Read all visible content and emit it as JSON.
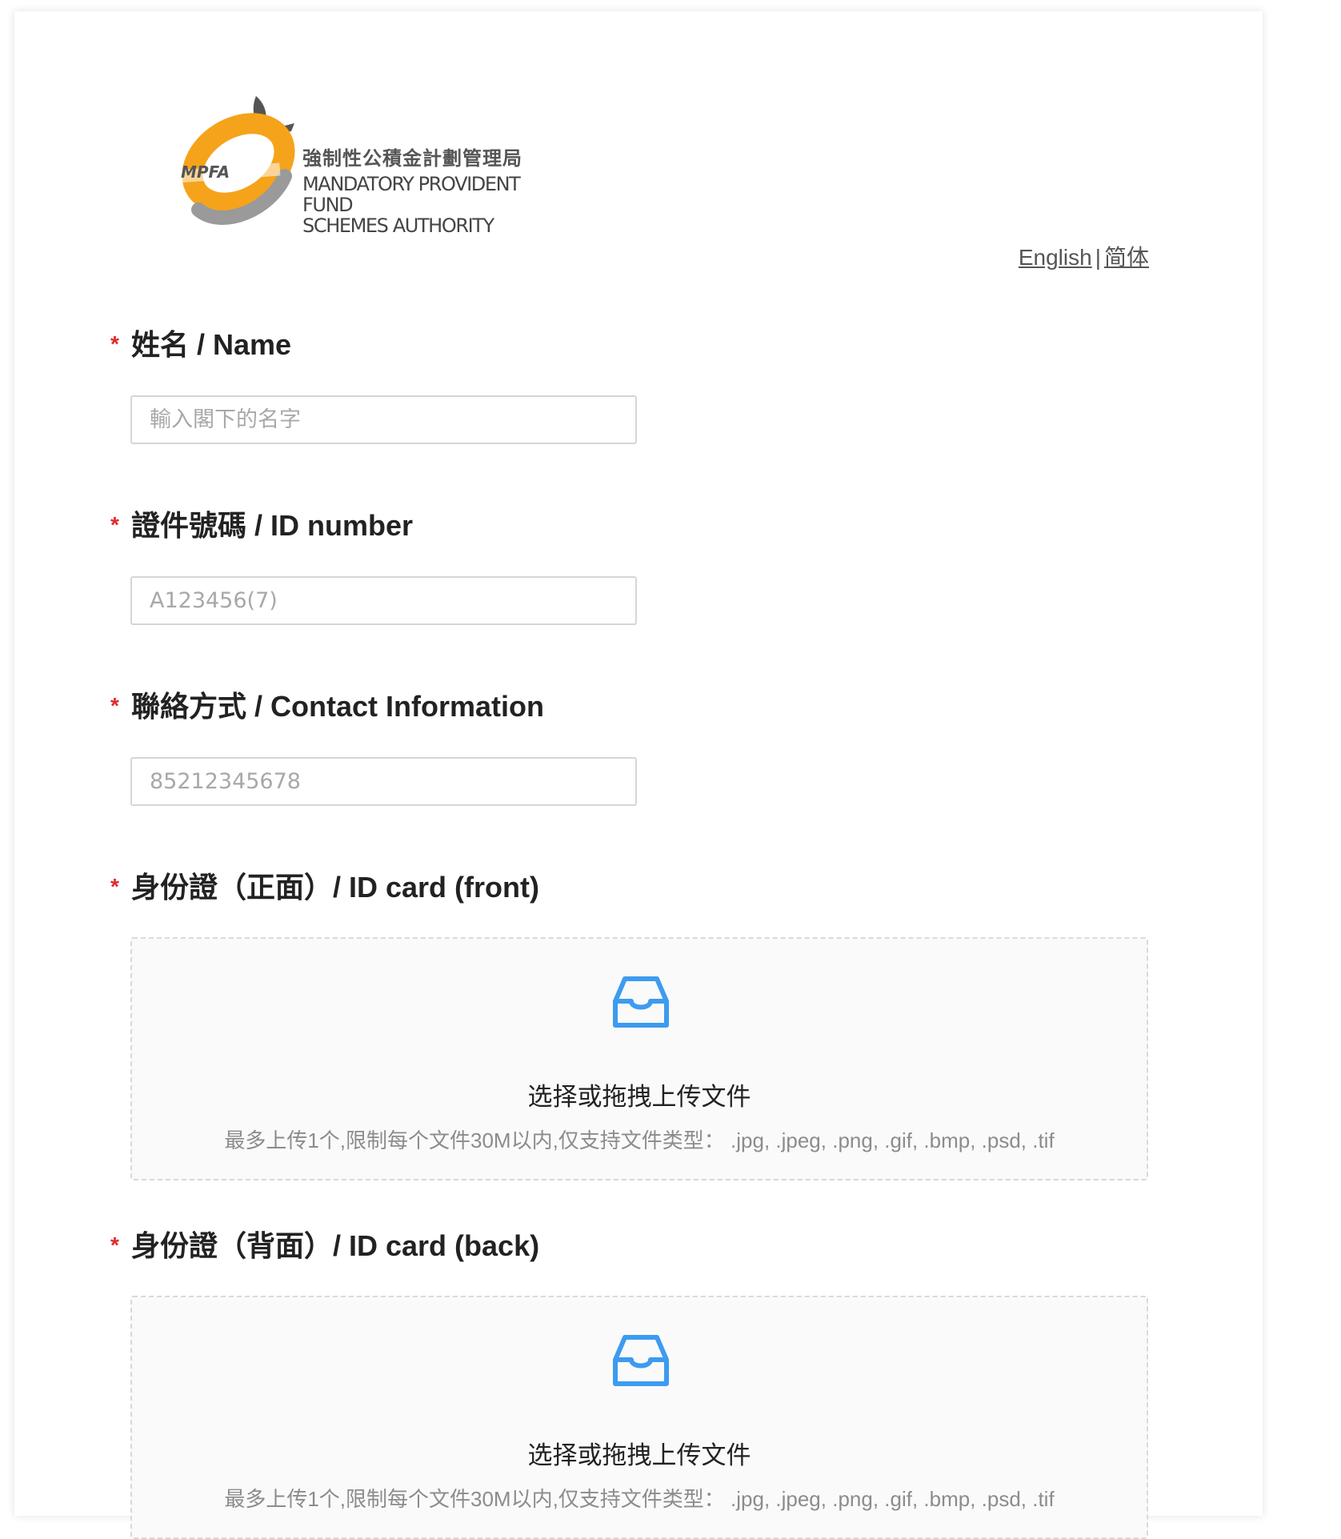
{
  "header": {
    "logo_abbr": "MPFA",
    "logo_name_zh": "強制性公積金計劃管理局",
    "logo_name_en_line1": "MANDATORY PROVIDENT FUND",
    "logo_name_en_line2": "SCHEMES AUTHORITY",
    "lang_english": "English",
    "lang_separator": "|",
    "lang_simplified": "简体"
  },
  "form": {
    "required_mark": "*",
    "name": {
      "label": "姓名 / Name",
      "placeholder": "輸入閣下的名字"
    },
    "id_number": {
      "label": "證件號碼 / ID number",
      "placeholder": "A123456(7)"
    },
    "contact": {
      "label": "聯絡方式 / Contact Information",
      "placeholder": "85212345678"
    },
    "id_front": {
      "label": "身份證（正面）/ ID card (front)",
      "upload_title": "选择或拖拽上传文件",
      "upload_hint": "最多上传1个,限制每个文件30M以内,仅支持文件类型： .jpg, .jpeg, .png, .gif, .bmp, .psd, .tif"
    },
    "id_back": {
      "label": "身份證（背面）/ ID card (back)",
      "upload_title": "选择或拖拽上传文件",
      "upload_hint": "最多上传1个,限制每个文件30M以内,仅支持文件类型： .jpg, .jpeg, .png, .gif, .bmp, .psd, .tif"
    }
  },
  "colors": {
    "required_star": "#e02a2a",
    "upload_icon": "#3d9bf0",
    "logo_orange": "#f5a31a",
    "logo_gray": "#8a8a8a"
  },
  "icons": {
    "upload": "inbox-icon"
  }
}
